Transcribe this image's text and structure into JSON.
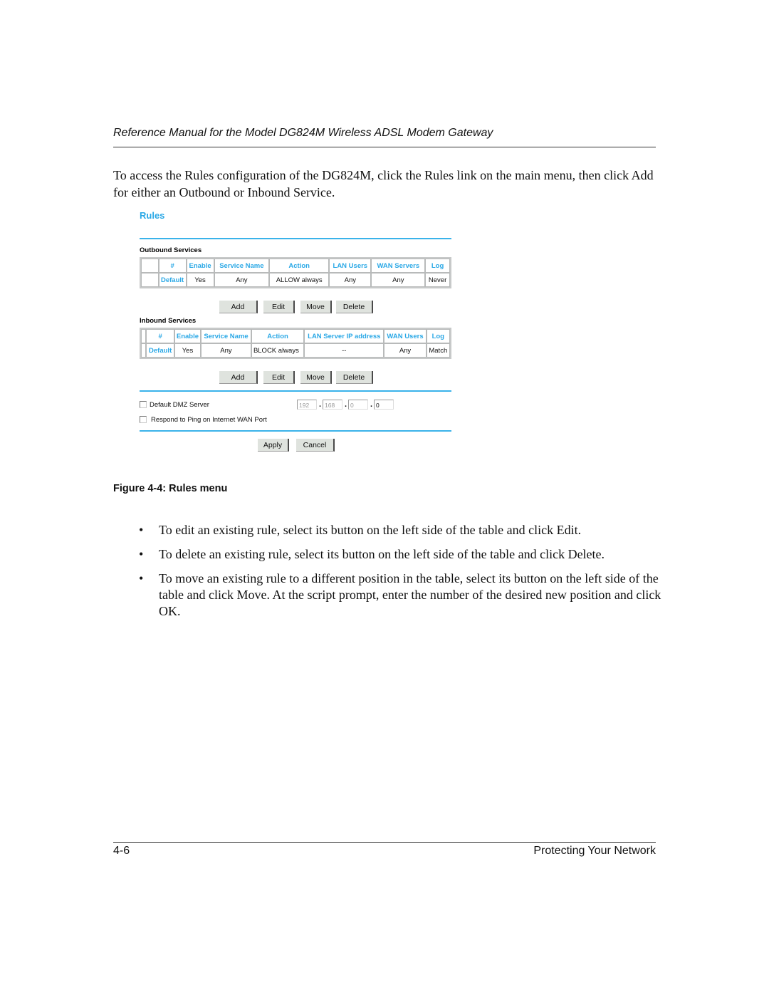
{
  "page": {
    "running_header": "Reference Manual for the Model DG824M Wireless ADSL Modem Gateway",
    "intro": "To access the Rules configuration of the DG824M, click the Rules link on the main menu, then click Add for either an Outbound or Inbound Service.",
    "figure_caption": "Figure 4-4: Rules menu",
    "bullet_char": "•",
    "bullets": [
      "To edit an existing rule, select its button on the left side of the table and click Edit.",
      "To delete an existing rule, select its button on the left side of the table and click Delete.",
      "To move an existing rule to a different position in the table, select its button on the left side of the table and click Move. At the script prompt, enter the number of the desired new position and click OK."
    ],
    "footer_left": "4-6",
    "footer_right": "Protecting Your Network"
  },
  "rules_ui": {
    "title": "Rules",
    "accent_color": "#2aa8e6",
    "outbound": {
      "label": "Outbound Services",
      "headers": [
        "",
        "#",
        "Enable",
        "Service Name",
        "Action",
        "LAN Users",
        "WAN Servers",
        "Log"
      ],
      "rows": [
        [
          "",
          "Default",
          "Yes",
          "Any",
          "ALLOW always",
          "Any",
          "Any",
          "Never"
        ]
      ]
    },
    "inbound": {
      "label": "Inbound Services",
      "headers": [
        "",
        "#",
        "Enable",
        "Service Name",
        "Action",
        "LAN Server IP address",
        "WAN Users",
        "Log"
      ],
      "rows": [
        [
          "",
          "Default",
          "Yes",
          "Any",
          "BLOCK always",
          "--",
          "Any",
          "Match"
        ]
      ]
    },
    "buttons": {
      "add": "Add",
      "edit": "Edit",
      "move": "Move",
      "delete": "Delete"
    },
    "dmz": {
      "label": "Default DMZ Server",
      "checked": false,
      "ip": [
        "192",
        "168",
        "0",
        "0"
      ],
      "separator": "."
    },
    "ping": {
      "label": "Respond to Ping on Internet WAN Port",
      "checked": false
    },
    "apply": "Apply",
    "cancel": "Cancel"
  }
}
